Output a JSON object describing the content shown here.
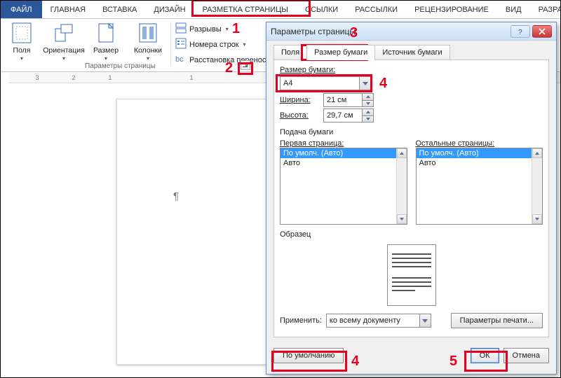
{
  "tabs": {
    "file": "ФАЙЛ",
    "home": "ГЛАВНАЯ",
    "insert": "ВСТАВКА",
    "design": "ДИЗАЙН",
    "layout": "РАЗМЕТКА СТРАНИЦЫ",
    "references": "ССЫЛКИ",
    "mailings": "РАССЫЛКИ",
    "review": "РЕЦЕНЗИРОВАНИЕ",
    "view": "ВИД",
    "devpartial": "РАЗРА"
  },
  "ribbon": {
    "margins": "Поля",
    "orientation": "Ориентация",
    "size": "Размер",
    "columns": "Колонки",
    "breaks": "Разрывы",
    "lineNumbers": "Номера строк",
    "hyphenation": "Расстановка переносов",
    "group": "Параметры страницы"
  },
  "ruler": {
    "n3": "3",
    "n2": "2",
    "n1": "1",
    "n1b": "1"
  },
  "dialog": {
    "title": "Параметры страницы",
    "tabs": {
      "margins": "Поля",
      "paper": "Размер бумаги",
      "source": "Источник бумаги"
    },
    "paperSizeLbl": "Размер бумаги:",
    "paperSize": "A4",
    "widthLbl": "Ширина:",
    "width": "21 см",
    "heightLbl": "Высота:",
    "height": "29,7 см",
    "feedLbl": "Подача бумаги",
    "firstLbl": "Первая страница:",
    "otherLbl": "Остальные страницы:",
    "opt1": "По умолч. (Авто)",
    "opt2": "Авто",
    "previewLbl": "Образец",
    "applyLbl": "Применить:",
    "applyVal": "ко всему документу",
    "printOpts": "Параметры печати...",
    "default": "По умолчанию",
    "ok": "ОК",
    "cancel": "Отмена"
  },
  "callouts": {
    "c1": "1",
    "c2": "2",
    "c3": "3",
    "c4": "4",
    "c4b": "4",
    "c5": "5"
  }
}
